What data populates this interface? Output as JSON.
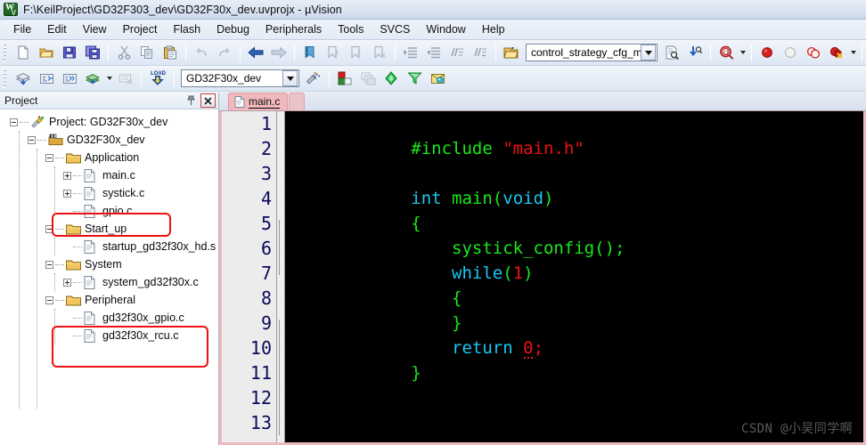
{
  "window": {
    "title": "F:\\KeilProject\\GD32F303_dev\\GD32F30x_dev.uvprojx - µVision",
    "app_icon": "keil-uvision-logo-icon"
  },
  "menubar": {
    "items": [
      {
        "label": "File"
      },
      {
        "label": "Edit"
      },
      {
        "label": "View"
      },
      {
        "label": "Project"
      },
      {
        "label": "Flash"
      },
      {
        "label": "Debug"
      },
      {
        "label": "Peripherals"
      },
      {
        "label": "Tools"
      },
      {
        "label": "SVCS"
      },
      {
        "label": "Window"
      },
      {
        "label": "Help"
      }
    ]
  },
  "toolbar_main": {
    "buttons": [
      {
        "name": "new-file-icon",
        "title": "New"
      },
      {
        "name": "open-file-icon",
        "title": "Open"
      },
      {
        "name": "save-icon",
        "title": "Save"
      },
      {
        "name": "save-all-icon",
        "title": "Save All"
      },
      {
        "name": "cut-icon",
        "title": "Cut"
      },
      {
        "name": "copy-icon",
        "title": "Copy"
      },
      {
        "name": "paste-icon",
        "title": "Paste"
      },
      {
        "name": "undo-icon",
        "title": "Undo"
      },
      {
        "name": "redo-icon",
        "title": "Redo"
      },
      {
        "name": "navigate-backward-icon",
        "title": "Back"
      },
      {
        "name": "navigate-forward-icon",
        "title": "Forward"
      },
      {
        "name": "bookmark-toggle-icon",
        "title": "Insert/Remove Bookmark"
      },
      {
        "name": "bookmark-prev-icon",
        "title": "Previous Bookmark"
      },
      {
        "name": "bookmark-next-icon",
        "title": "Next Bookmark"
      },
      {
        "name": "bookmark-clear-icon",
        "title": "Clear All Bookmarks"
      },
      {
        "name": "indent-right-icon",
        "title": "Indent"
      },
      {
        "name": "indent-left-icon",
        "title": "Outdent"
      },
      {
        "name": "comment-icon",
        "title": "Comment Selection"
      },
      {
        "name": "uncomment-icon",
        "title": "Uncomment Selection"
      },
      {
        "name": "open-project-icon",
        "title": "Open Project"
      }
    ],
    "file_combo": {
      "value": "control_strategy_cfg_m_c",
      "name": "file-search-combo"
    },
    "right_buttons": [
      {
        "name": "find-in-files-icon",
        "title": "Find in Files"
      },
      {
        "name": "incremental-find-icon",
        "title": "Incremental Find"
      },
      {
        "name": "magnifier-find-icon",
        "title": "Find"
      },
      {
        "name": "breakpoint-icon",
        "title": "Insert/Remove Breakpoint"
      },
      {
        "name": "breakpoint-disable-icon",
        "title": "Enable/Disable Breakpoint"
      },
      {
        "name": "breakpoint-disable-all-icon",
        "title": "Disable All Breakpoints"
      },
      {
        "name": "breakpoint-kill-all-icon",
        "title": "Kill All Breakpoints"
      },
      {
        "name": "project-window-icon",
        "title": "Project Window"
      },
      {
        "name": "configure-icon",
        "title": "Configuration Wizard"
      }
    ]
  },
  "toolbar_build": {
    "buttons": [
      {
        "name": "translate-icon",
        "title": "Translate"
      },
      {
        "name": "build-icon",
        "title": "Build"
      },
      {
        "name": "rebuild-icon",
        "title": "Rebuild"
      },
      {
        "name": "batch-build-icon",
        "title": "Batch Build"
      },
      {
        "name": "stop-build-icon",
        "title": "Stop Build"
      },
      {
        "name": "download-icon",
        "title": "Download"
      }
    ],
    "target_combo": {
      "value": "GD32F30x_dev",
      "name": "target-select-combo"
    },
    "right_buttons": [
      {
        "name": "target-options-icon",
        "title": "Options for Target"
      },
      {
        "name": "manage-project-items-icon",
        "title": "Manage Project Items"
      },
      {
        "name": "multi-project-icon",
        "title": "Multi-Project"
      },
      {
        "name": "pack-installer-icon",
        "title": "Pack Installer"
      },
      {
        "name": "manage-run-env-icon",
        "title": "Manage Run-Time Environment"
      },
      {
        "name": "select-software-packs-icon",
        "title": "Select Software Packs"
      }
    ]
  },
  "project_panel": {
    "title": "Project",
    "pin_icon": "pin-icon",
    "close_icon": "close-icon",
    "tree": [
      {
        "depth": 0,
        "label": "Project: GD32F30x_dev",
        "icon": "project-root-icon",
        "expander": "minus",
        "highlighted": false
      },
      {
        "depth": 1,
        "label": "GD32F30x_dev",
        "icon": "target-icon",
        "expander": "minus",
        "highlighted": false
      },
      {
        "depth": 2,
        "label": "Application",
        "icon": "folder-icon",
        "expander": "minus",
        "highlighted": false
      },
      {
        "depth": 3,
        "label": "main.c",
        "icon": "c-file-icon",
        "expander": "plus",
        "highlighted": false
      },
      {
        "depth": 3,
        "label": "systick.c",
        "icon": "c-file-icon",
        "expander": "plus",
        "highlighted": false
      },
      {
        "depth": 3,
        "label": "gpio.c",
        "icon": "c-file-icon",
        "expander": "none",
        "highlighted": true
      },
      {
        "depth": 2,
        "label": "Start_up",
        "icon": "folder-icon",
        "expander": "minus",
        "highlighted": false
      },
      {
        "depth": 3,
        "label": "startup_gd32f30x_hd.s",
        "icon": "asm-file-icon",
        "expander": "none",
        "highlighted": false
      },
      {
        "depth": 2,
        "label": "System",
        "icon": "folder-icon",
        "expander": "minus",
        "highlighted": false
      },
      {
        "depth": 3,
        "label": "system_gd32f30x.c",
        "icon": "c-file-icon",
        "expander": "plus",
        "highlighted": false
      },
      {
        "depth": 2,
        "label": "Peripheral",
        "icon": "folder-icon",
        "expander": "minus",
        "highlighted": false
      },
      {
        "depth": 3,
        "label": "gd32f30x_gpio.c",
        "icon": "c-file-icon",
        "expander": "none",
        "highlighted": true
      },
      {
        "depth": 3,
        "label": "gd32f30x_rcu.c",
        "icon": "c-file-icon",
        "expander": "none",
        "highlighted": true
      }
    ],
    "annotations": [
      {
        "name": "redbox-gpio-c",
        "color": "#ee1111"
      },
      {
        "name": "redbox-peripheral-files",
        "color": "#ee1111"
      }
    ]
  },
  "editor": {
    "tabs": [
      {
        "label": "main.c",
        "icon": "c-file-icon",
        "active": true
      }
    ],
    "gutter_lines": [
      "1",
      "2",
      "3",
      "4",
      "5",
      "6",
      "7",
      "8",
      "9",
      "10",
      "11",
      "12",
      "13"
    ],
    "warning_line": 9,
    "warning_icon": "warning-triangle-icon",
    "lines": [
      {
        "n": 1,
        "tokens": [
          {
            "t": "#include ",
            "c": "green"
          },
          {
            "t": "\"main.h\"",
            "c": "red"
          }
        ]
      },
      {
        "n": 2,
        "tokens": []
      },
      {
        "n": 3,
        "tokens": [
          {
            "t": "int ",
            "c": "blue"
          },
          {
            "t": "main(",
            "c": "green"
          },
          {
            "t": "void",
            "c": "blue"
          },
          {
            "t": ")",
            "c": "green"
          }
        ]
      },
      {
        "n": 4,
        "tokens": [
          {
            "t": "{",
            "c": "green"
          }
        ]
      },
      {
        "n": 5,
        "tokens": [
          {
            "t": "    systick_config();",
            "c": "green"
          }
        ]
      },
      {
        "n": 6,
        "tokens": [
          {
            "t": "    while",
            "c": "blue"
          },
          {
            "t": "(",
            "c": "green"
          },
          {
            "t": "1",
            "c": "red"
          },
          {
            "t": ")",
            "c": "green"
          }
        ]
      },
      {
        "n": 7,
        "tokens": [
          {
            "t": "    {",
            "c": "green"
          }
        ]
      },
      {
        "n": 8,
        "tokens": [
          {
            "t": "    }",
            "c": "green"
          }
        ]
      },
      {
        "n": 9,
        "tokens": [
          {
            "t": "    return ",
            "c": "blue"
          },
          {
            "t": "0",
            "c": "red-squiggle"
          },
          {
            "t": ";",
            "c": "red"
          }
        ]
      },
      {
        "n": 10,
        "tokens": [
          {
            "t": "}",
            "c": "green"
          }
        ]
      },
      {
        "n": 11,
        "tokens": []
      },
      {
        "n": 12,
        "tokens": []
      },
      {
        "n": 13,
        "tokens": []
      }
    ],
    "watermark": "CSDN @小吴同学啊",
    "colors": {
      "background": "#000000",
      "green": "#1ae81a",
      "red": "#f01010",
      "blue": "#18c8f0",
      "line_number": "#0b0b5a",
      "gutter_background": "#ececed"
    }
  }
}
